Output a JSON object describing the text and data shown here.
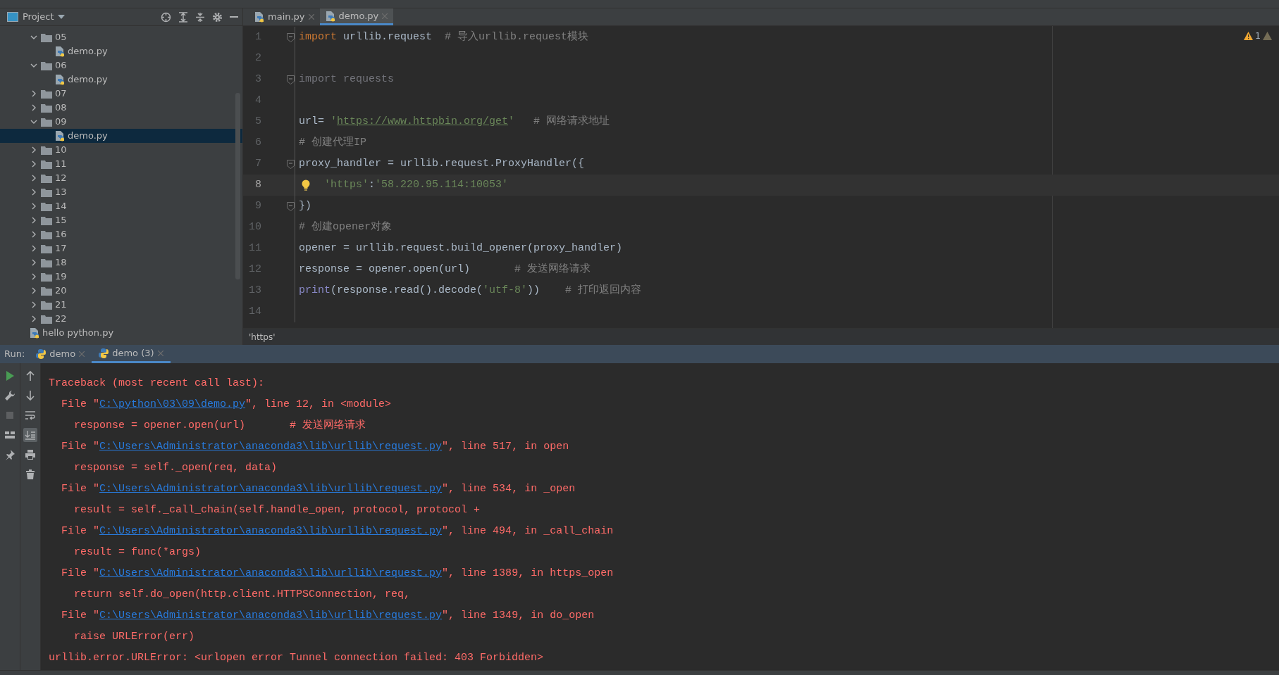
{
  "project_panel": {
    "title": "Project",
    "tree": [
      {
        "label": "05",
        "kind": "folder",
        "expanded": true,
        "selected": false,
        "children": [
          {
            "label": "demo.py",
            "kind": "file",
            "selected": false
          }
        ]
      },
      {
        "label": "06",
        "kind": "folder",
        "expanded": true,
        "selected": false,
        "children": [
          {
            "label": "demo.py",
            "kind": "file",
            "selected": false
          }
        ]
      },
      {
        "label": "07",
        "kind": "folder",
        "expanded": false,
        "selected": false
      },
      {
        "label": "08",
        "kind": "folder",
        "expanded": false,
        "selected": false
      },
      {
        "label": "09",
        "kind": "folder",
        "expanded": true,
        "selected": false,
        "children": [
          {
            "label": "demo.py",
            "kind": "file",
            "selected": true
          }
        ]
      },
      {
        "label": "10",
        "kind": "folder",
        "expanded": false,
        "selected": false
      },
      {
        "label": "11",
        "kind": "folder",
        "expanded": false,
        "selected": false
      },
      {
        "label": "12",
        "kind": "folder",
        "expanded": false,
        "selected": false
      },
      {
        "label": "13",
        "kind": "folder",
        "expanded": false,
        "selected": false
      },
      {
        "label": "14",
        "kind": "folder",
        "expanded": false,
        "selected": false
      },
      {
        "label": "15",
        "kind": "folder",
        "expanded": false,
        "selected": false
      },
      {
        "label": "16",
        "kind": "folder",
        "expanded": false,
        "selected": false
      },
      {
        "label": "17",
        "kind": "folder",
        "expanded": false,
        "selected": false
      },
      {
        "label": "18",
        "kind": "folder",
        "expanded": false,
        "selected": false
      },
      {
        "label": "19",
        "kind": "folder",
        "expanded": false,
        "selected": false
      },
      {
        "label": "20",
        "kind": "folder",
        "expanded": false,
        "selected": false
      },
      {
        "label": "21",
        "kind": "folder",
        "expanded": false,
        "selected": false
      },
      {
        "label": "22",
        "kind": "folder",
        "expanded": false,
        "selected": false
      },
      {
        "label": "hello python.py",
        "kind": "file",
        "selected": false
      }
    ]
  },
  "editor": {
    "tabs": [
      {
        "label": "main.py",
        "selected": false
      },
      {
        "label": "demo.py",
        "selected": true
      }
    ],
    "warning_count": "1",
    "lines": [
      {
        "number": "1",
        "fold": true,
        "current": false,
        "bulb": false,
        "tokens": [
          {
            "text": "import",
            "kind": "keyword"
          },
          {
            "text": " urllib.request  ",
            "kind": "plain"
          },
          {
            "text": "# 导入urllib.request模块",
            "kind": "comment"
          }
        ]
      },
      {
        "number": "2",
        "fold": false,
        "current": false,
        "bulb": false
      },
      {
        "number": "3",
        "fold": true,
        "current": false,
        "bulb": false,
        "tokens": [
          {
            "text": "import requests",
            "kind": "unused"
          }
        ]
      },
      {
        "number": "4",
        "fold": false,
        "current": false,
        "bulb": false
      },
      {
        "number": "5",
        "fold": false,
        "current": false,
        "bulb": false,
        "tokens": [
          {
            "text": "url= ",
            "kind": "plain"
          },
          {
            "text": "'",
            "kind": "string"
          },
          {
            "text": "https://www.httpbin.org/get",
            "kind": "url"
          },
          {
            "text": "'",
            "kind": "string"
          },
          {
            "text": "   # 网络请求地址",
            "kind": "comment"
          }
        ]
      },
      {
        "number": "6",
        "fold": false,
        "current": false,
        "bulb": false,
        "tokens": [
          {
            "text": "# 创建代理IP",
            "kind": "comment"
          }
        ]
      },
      {
        "number": "7",
        "fold": true,
        "current": false,
        "bulb": false,
        "tokens": [
          {
            "text": "proxy_handler = urllib.request.ProxyHandler({",
            "kind": "plain"
          }
        ]
      },
      {
        "number": "8",
        "fold": false,
        "current": true,
        "bulb": true,
        "tokens": [
          {
            "text": "'https'",
            "kind": "string"
          },
          {
            "text": ":",
            "kind": "plain"
          },
          {
            "text": "'58.220.95.114:10053'",
            "kind": "string"
          }
        ]
      },
      {
        "number": "9",
        "fold": true,
        "current": false,
        "bulb": false,
        "tokens": [
          {
            "text": "})",
            "kind": "plain"
          }
        ]
      },
      {
        "number": "10",
        "fold": false,
        "current": false,
        "bulb": false,
        "tokens": [
          {
            "text": "# 创建opener对象",
            "kind": "comment"
          }
        ]
      },
      {
        "number": "11",
        "fold": false,
        "current": false,
        "bulb": false,
        "tokens": [
          {
            "text": "opener = urllib.request.build_opener(proxy_handler)",
            "kind": "plain"
          }
        ]
      },
      {
        "number": "12",
        "fold": false,
        "current": false,
        "bulb": false,
        "tokens": [
          {
            "text": "response = opener.open(url)       ",
            "kind": "plain"
          },
          {
            "text": "# 发送网络请求",
            "kind": "comment"
          }
        ]
      },
      {
        "number": "13",
        "fold": false,
        "current": false,
        "bulb": false,
        "tokens": [
          {
            "text": "print",
            "kind": "builtin"
          },
          {
            "text": "(response.read().decode(",
            "kind": "plain"
          },
          {
            "text": "'utf-8'",
            "kind": "string"
          },
          {
            "text": "))    ",
            "kind": "plain"
          },
          {
            "text": "# 打印返回内容",
            "kind": "comment"
          }
        ]
      },
      {
        "number": "14",
        "fold": false,
        "current": false,
        "bulb": false
      }
    ],
    "breadcrumb": "'https'"
  },
  "run": {
    "label": "Run:",
    "tabs": [
      {
        "label": "demo",
        "selected": false
      },
      {
        "label": "demo (3)",
        "selected": true
      }
    ],
    "output": [
      {
        "parts": [
          {
            "text": "Traceback (most recent call last):",
            "link": false
          }
        ]
      },
      {
        "parts": [
          {
            "text": "  File \"",
            "link": false
          },
          {
            "text": "C:\\python\\03\\09\\demo.py",
            "link": true
          },
          {
            "text": "\", line 12, in <module>",
            "link": false
          }
        ]
      },
      {
        "parts": [
          {
            "text": "    response = opener.open(url)       # 发送网络请求",
            "link": false
          }
        ]
      },
      {
        "parts": [
          {
            "text": "  File \"",
            "link": false
          },
          {
            "text": "C:\\Users\\Administrator\\anaconda3\\lib\\urllib\\request.py",
            "link": true
          },
          {
            "text": "\", line 517, in open",
            "link": false
          }
        ]
      },
      {
        "parts": [
          {
            "text": "    response = self._open(req, data)",
            "link": false
          }
        ]
      },
      {
        "parts": [
          {
            "text": "  File \"",
            "link": false
          },
          {
            "text": "C:\\Users\\Administrator\\anaconda3\\lib\\urllib\\request.py",
            "link": true
          },
          {
            "text": "\", line 534, in _open",
            "link": false
          }
        ]
      },
      {
        "parts": [
          {
            "text": "    result = self._call_chain(self.handle_open, protocol, protocol +",
            "link": false
          }
        ]
      },
      {
        "parts": [
          {
            "text": "  File \"",
            "link": false
          },
          {
            "text": "C:\\Users\\Administrator\\anaconda3\\lib\\urllib\\request.py",
            "link": true
          },
          {
            "text": "\", line 494, in _call_chain",
            "link": false
          }
        ]
      },
      {
        "parts": [
          {
            "text": "    result = func(*args)",
            "link": false
          }
        ]
      },
      {
        "parts": [
          {
            "text": "  File \"",
            "link": false
          },
          {
            "text": "C:\\Users\\Administrator\\anaconda3\\lib\\urllib\\request.py",
            "link": true
          },
          {
            "text": "\", line 1389, in https_open",
            "link": false
          }
        ]
      },
      {
        "parts": [
          {
            "text": "    return self.do_open(http.client.HTTPSConnection, req,",
            "link": false
          }
        ]
      },
      {
        "parts": [
          {
            "text": "  File \"",
            "link": false
          },
          {
            "text": "C:\\Users\\Administrator\\anaconda3\\lib\\urllib\\request.py",
            "link": true
          },
          {
            "text": "\", line 1349, in do_open",
            "link": false
          }
        ]
      },
      {
        "parts": [
          {
            "text": "    raise URLError(err)",
            "link": false
          }
        ]
      },
      {
        "parts": [
          {
            "text": "urllib.error.URLError: <urlopen error Tunnel connection failed: 403 Forbidden>",
            "link": false
          }
        ]
      }
    ]
  }
}
